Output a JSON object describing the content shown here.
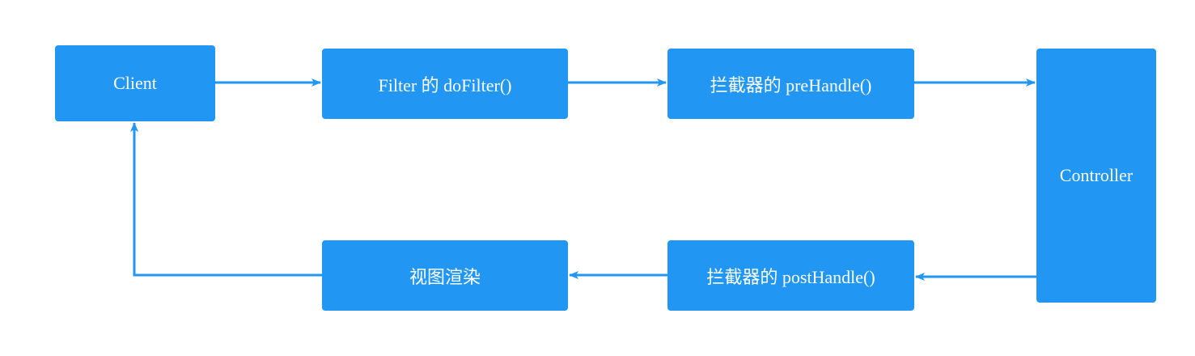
{
  "diagram": {
    "nodes": {
      "client": "Client",
      "filter": "Filter 的 doFilter()",
      "prehandle": "拦截器的 preHandle()",
      "controller": "Controller",
      "posthandle": "拦截器的 postHandle()",
      "render": "视图渲染"
    },
    "edges": [
      {
        "from": "client",
        "to": "filter"
      },
      {
        "from": "filter",
        "to": "prehandle"
      },
      {
        "from": "prehandle",
        "to": "controller"
      },
      {
        "from": "controller",
        "to": "posthandle"
      },
      {
        "from": "posthandle",
        "to": "render"
      },
      {
        "from": "render",
        "to": "client"
      }
    ],
    "colors": {
      "node_fill": "#2196f3",
      "edge": "#2196f3",
      "text": "#ffffff"
    }
  }
}
